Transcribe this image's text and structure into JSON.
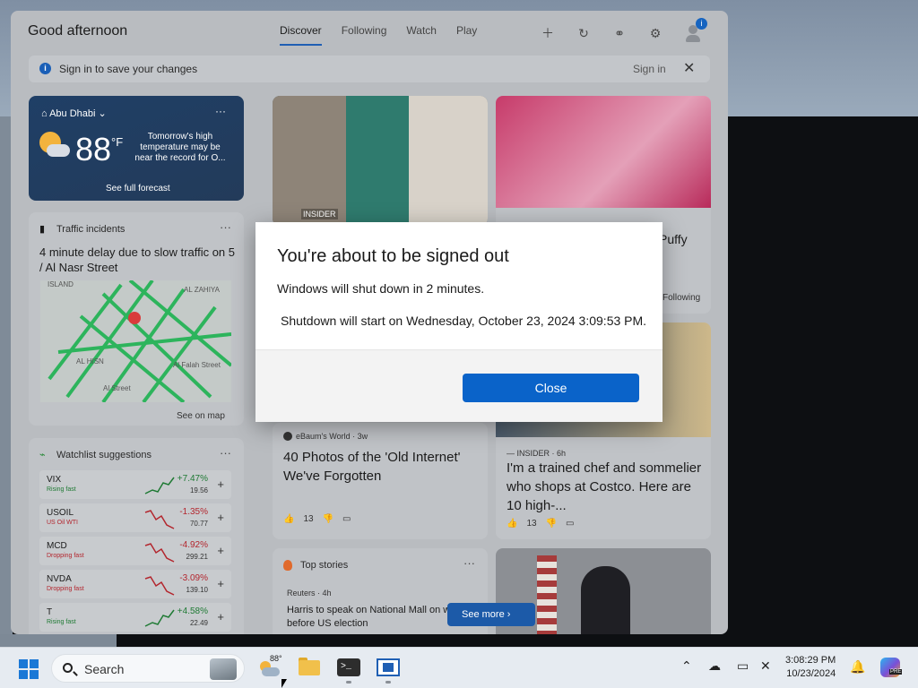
{
  "widgets": {
    "greeting": "Good afternoon",
    "tabs": [
      "Discover",
      "Following",
      "Watch",
      "Play"
    ],
    "active_tab": "Discover",
    "signin_bar": {
      "message": "Sign in to save your changes",
      "link": "Sign in"
    },
    "weather": {
      "location": "Abu Dhabi",
      "temperature": "88",
      "unit": "°F",
      "alert": "Tomorrow's high temperature may be near the record for O...",
      "forecast_link": "See full forecast"
    },
    "traffic": {
      "title": "Traffic incidents",
      "headline": "4 minute delay due to slow traffic on 5 / Al Nasr Street",
      "map_labels": [
        "ISLAND",
        "AL ZAHIYA",
        "AL HISN",
        "Al Falah Street",
        "Al Falah Street",
        "Al Street"
      ],
      "see_on_map": "See on map"
    },
    "watchlist": {
      "title": "Watchlist suggestions",
      "stocks": [
        {
          "symbol": "VIX",
          "sub": "Rising fast",
          "pct": "+7.47%",
          "price": "19.56",
          "trend": "up"
        },
        {
          "symbol": "USOIL",
          "sub": "US Oil WTI",
          "pct": "-1.35%",
          "price": "70.77",
          "trend": "down"
        },
        {
          "symbol": "MCD",
          "sub": "Dropping fast",
          "pct": "-4.92%",
          "price": "299.21",
          "trend": "down"
        },
        {
          "symbol": "NVDA",
          "sub": "Dropping fast",
          "pct": "-3.09%",
          "price": "139.10",
          "trend": "down"
        },
        {
          "symbol": "T",
          "sub": "Rising fast",
          "pct": "+4.58%",
          "price": "22.49",
          "trend": "up"
        }
      ]
    },
    "news": [
      {
        "source": "INSIDER"
      },
      {
        "title_fragment": "Puffy",
        "follow": "Following"
      },
      {
        "source": "eBaum's World",
        "age": "3w",
        "title": "40 Photos of the 'Old Internet' We've Forgotten",
        "likes": "13"
      },
      {
        "source": "INSIDER",
        "age": "6h",
        "title": "I'm a trained chef and sommelier who shops at Costco. Here are 10 high-...",
        "likes": "13"
      }
    ],
    "top_stories": {
      "title": "Top stories",
      "source": "Reuters",
      "age": "4h",
      "headline": "Harris to speak on National Mall on week before US election",
      "see_more": "See more"
    }
  },
  "dialog": {
    "title": "You're about to be signed out",
    "message": "Windows will shut down in 2 minutes.",
    "detail": "Shutdown will start on Wednesday, October 23, 2024 3:09:53 PM.",
    "close_label": "Close"
  },
  "taskbar": {
    "search_placeholder": "Search",
    "weather_temp": "88°",
    "time": "3:08:29 PM",
    "date": "10/23/2024",
    "copilot_badge": "PRE"
  },
  "colors": {
    "accent": "#0a63c9",
    "brand": "#1f5fb4"
  }
}
